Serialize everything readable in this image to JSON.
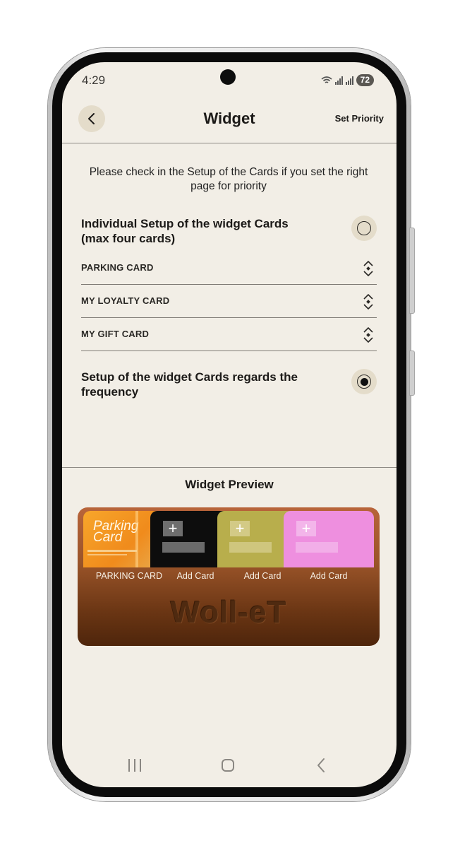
{
  "status_bar": {
    "time": "4:29",
    "battery": "72"
  },
  "header": {
    "title": "Widget",
    "set_priority_label": "Set Priority"
  },
  "instruction": "Please check in the Setup of the Cards if you set the right page for priority",
  "option_individual": {
    "label": "Individual Setup of the widget Cards (max four cards)",
    "selected": false
  },
  "card_list": [
    {
      "label": "PARKING CARD"
    },
    {
      "label": "MY LOYALTY CARD"
    },
    {
      "label": "MY GIFT CARD"
    }
  ],
  "option_frequency": {
    "label": "Setup of the widget Cards regards the frequency",
    "selected": true
  },
  "preview": {
    "title": "Widget Preview",
    "parking_card_art": "Parking Card",
    "slots": [
      {
        "label": "PARKING CARD",
        "color": "#f39a22"
      },
      {
        "label": "Add Card",
        "color": "#0d0d0d"
      },
      {
        "label": "Add Card",
        "color": "#b8ae4c"
      },
      {
        "label": "Add Card",
        "color": "#ee8fdf"
      }
    ],
    "brand": "Woll-eT"
  },
  "colors": {
    "background": "#f2eee6",
    "accent_chip": "#e4dcca",
    "widget_brown": "#6b3614"
  },
  "icons": [
    "back-chevron-icon",
    "wifi-icon",
    "signal-icon",
    "sort-arrows-icon",
    "plus-icon",
    "nav-recents-icon",
    "nav-home-icon",
    "nav-back-icon"
  ]
}
